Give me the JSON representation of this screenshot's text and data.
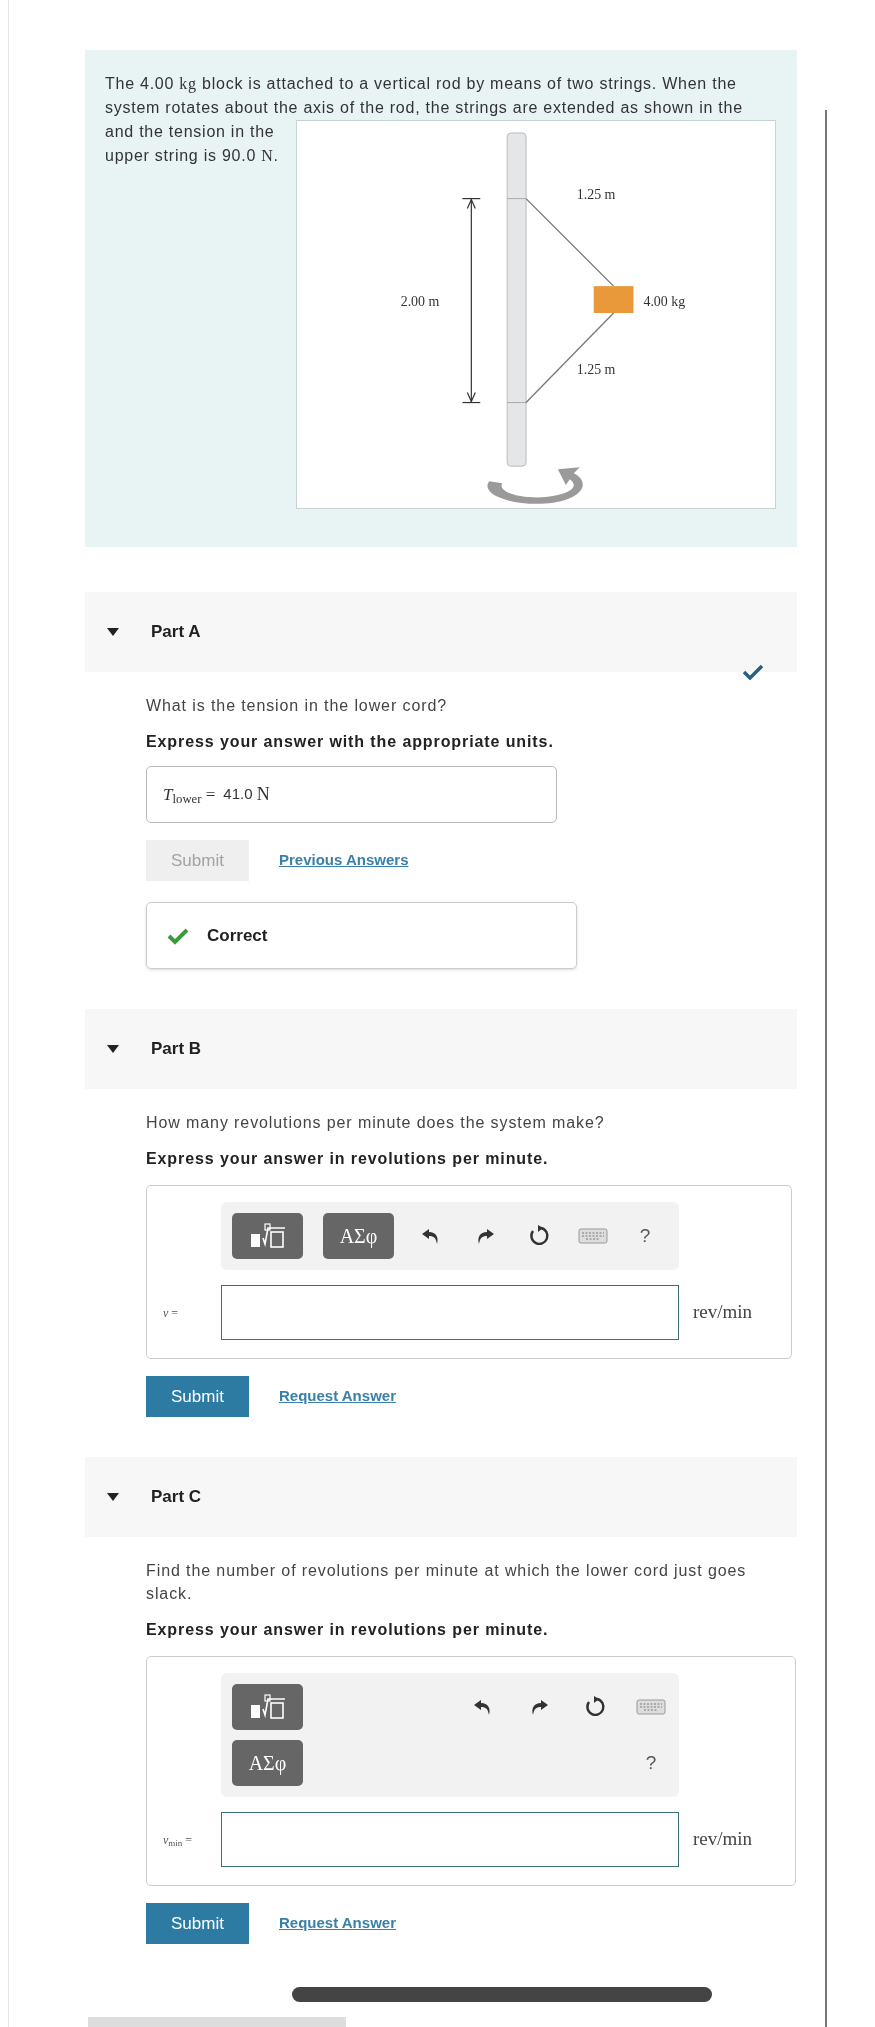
{
  "intro": {
    "text": [
      {
        "kind": "plain",
        "text": "The 4.00 "
      },
      {
        "kind": "math",
        "text": "kg"
      },
      {
        "kind": "plain",
        "text": " block is attached to a vertical rod by means of two strings. When the system rotates about the axis of the rod, the strings are extended as shown in the and the tension in the upper string is 90.0 "
      },
      {
        "kind": "math",
        "text": "N"
      },
      {
        "kind": "plain",
        "text": "."
      }
    ],
    "figure": {
      "upper_length": "1.25 m",
      "height": "2.00 m",
      "mass": "4.00 kg",
      "lower_length": "1.25 m"
    }
  },
  "parts": [
    {
      "title": "Part A",
      "expanded": true,
      "completed": true,
      "question": "What is the tension in the lower cord?",
      "instruction": "Express your answer with the appropriate units.",
      "answer": {
        "kind": "filled",
        "symbol": "*T*$_{lower}$ =",
        "value": "41.0",
        "unit": "N"
      },
      "submit": {
        "label": "Submit",
        "disabled": true
      },
      "link": "Previous Answers",
      "feedback": {
        "kind": "correct",
        "text": "Correct"
      }
    },
    {
      "title": "Part B",
      "expanded": true,
      "completed": false,
      "question": "How many revolutions per minute does the system make?",
      "instruction": "Express your answer in revolutions per minute.",
      "answer": {
        "kind": "wide_editor",
        "symbol": "*ν* =",
        "unit": "rev/min",
        "toolbar": [
          {
            "kind": "templates"
          },
          {
            "kind": "symbols",
            "label": "ΑΣφ"
          },
          {
            "kind": "undo"
          },
          {
            "kind": "redo"
          },
          {
            "kind": "reset"
          },
          {
            "kind": "keyboard"
          },
          {
            "kind": "help",
            "label": "?"
          }
        ]
      },
      "submit": {
        "label": "Submit",
        "disabled": false
      },
      "link": "Request Answer"
    },
    {
      "title": "Part C",
      "expanded": true,
      "completed": false,
      "question": "Find the number of revolutions per minute at which the lower cord just goes slack.",
      "instruction": "Express your answer in revolutions per minute.",
      "answer": {
        "kind": "stacked_editor",
        "symbol": "*ν*$_{min}$ =",
        "unit": "rev/min",
        "toolbar": [
          {
            "kind": "templates"
          },
          {
            "kind": "symbols",
            "label": "ΑΣφ"
          },
          {
            "kind": "undo"
          },
          {
            "kind": "redo"
          },
          {
            "kind": "reset"
          },
          {
            "kind": "keyboard"
          },
          {
            "kind": "help",
            "label": "?"
          }
        ]
      },
      "submit": {
        "label": "Submit",
        "disabled": false
      },
      "link": "Request Answer"
    }
  ]
}
